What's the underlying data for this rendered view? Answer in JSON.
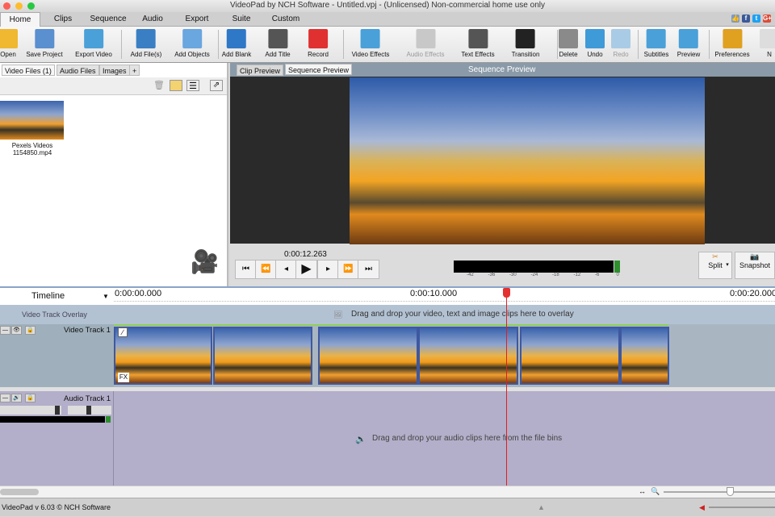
{
  "window": {
    "title": "VideoPad by NCH Software - Untitled.vpj - (Unlicensed) Non-commercial home use only"
  },
  "menu_tabs": [
    "Home",
    "Clips",
    "Sequence",
    "Audio",
    "Export",
    "Suite",
    "Custom"
  ],
  "social": [
    "like",
    "f",
    "t",
    "G+"
  ],
  "toolbar": [
    {
      "label": "Open",
      "icon": "folder-icon",
      "color": "#f0b830"
    },
    {
      "label": "Save Project",
      "icon": "floppy-icon",
      "color": "#5a8fd0"
    },
    {
      "label": "Export Video",
      "icon": "export-video-icon",
      "color": "#4aa0d8"
    },
    {
      "label": "Add File(s)",
      "icon": "add-file-icon",
      "color": "#3a7fc4"
    },
    {
      "label": "Add Objects",
      "icon": "add-objects-icon",
      "color": "#6aa6e0"
    },
    {
      "label": "Add Blank",
      "icon": "add-blank-icon",
      "color": "#2f78c8"
    },
    {
      "label": "Add Title",
      "icon": "add-title-icon",
      "color": "#555555"
    },
    {
      "label": "Record",
      "icon": "record-icon",
      "color": "#e03030"
    },
    {
      "label": "Video Effects",
      "icon": "video-effects-icon",
      "color": "#4aa0d8"
    },
    {
      "label": "Audio Effects",
      "icon": "audio-effects-icon",
      "color": "#c8c8c8",
      "disabled": true
    },
    {
      "label": "Text Effects",
      "icon": "text-effects-icon",
      "color": "#555555"
    },
    {
      "label": "Transition",
      "icon": "transition-icon",
      "color": "#222222"
    },
    {
      "label": "Delete",
      "icon": "trash-icon",
      "color": "#8a8a8a"
    },
    {
      "label": "Undo",
      "icon": "undo-icon",
      "color": "#3f9ad8"
    },
    {
      "label": "Redo",
      "icon": "redo-icon",
      "color": "#a9cbe6",
      "disabled": true
    },
    {
      "label": "Subtitles",
      "icon": "subtitles-icon",
      "color": "#4aa0d8"
    },
    {
      "label": "Preview",
      "icon": "preview-icon",
      "color": "#4aa0d8"
    },
    {
      "label": "Preferences",
      "icon": "preferences-icon",
      "color": "#e0a020"
    },
    {
      "label": "N",
      "icon": "more-icon",
      "color": "#dddddd"
    }
  ],
  "bins": {
    "tabs": [
      "Video Files (1)",
      "Audio Files",
      "Images",
      "+"
    ],
    "files": [
      {
        "name": "Pexels Videos 1154850.mp4"
      }
    ]
  },
  "preview": {
    "tabs": [
      "Clip Preview",
      "Sequence Preview"
    ],
    "header": "Sequence Preview",
    "time": "0:00:12.263",
    "meter_ticks": [
      "-42",
      "-36",
      "-30",
      "-24",
      "-18",
      "-12",
      "-6",
      "0"
    ],
    "split": "Split",
    "snapshot": "Snapshot"
  },
  "timeline": {
    "label": "Timeline",
    "ticks": [
      "0:00:00.000",
      "0:00:10.000",
      "0:00:20.000"
    ],
    "overlay_label": "Video Track Overlay",
    "overlay_hint": "Drag and drop your video, text and image clips here to overlay",
    "video_track": "Video Track 1",
    "audio_track": "Audio Track 1",
    "audio_hint": "Drag and drop your audio clips here from the file bins",
    "fx": "FX"
  },
  "status": {
    "text": "VideoPad v 6.03 © NCH Software"
  }
}
